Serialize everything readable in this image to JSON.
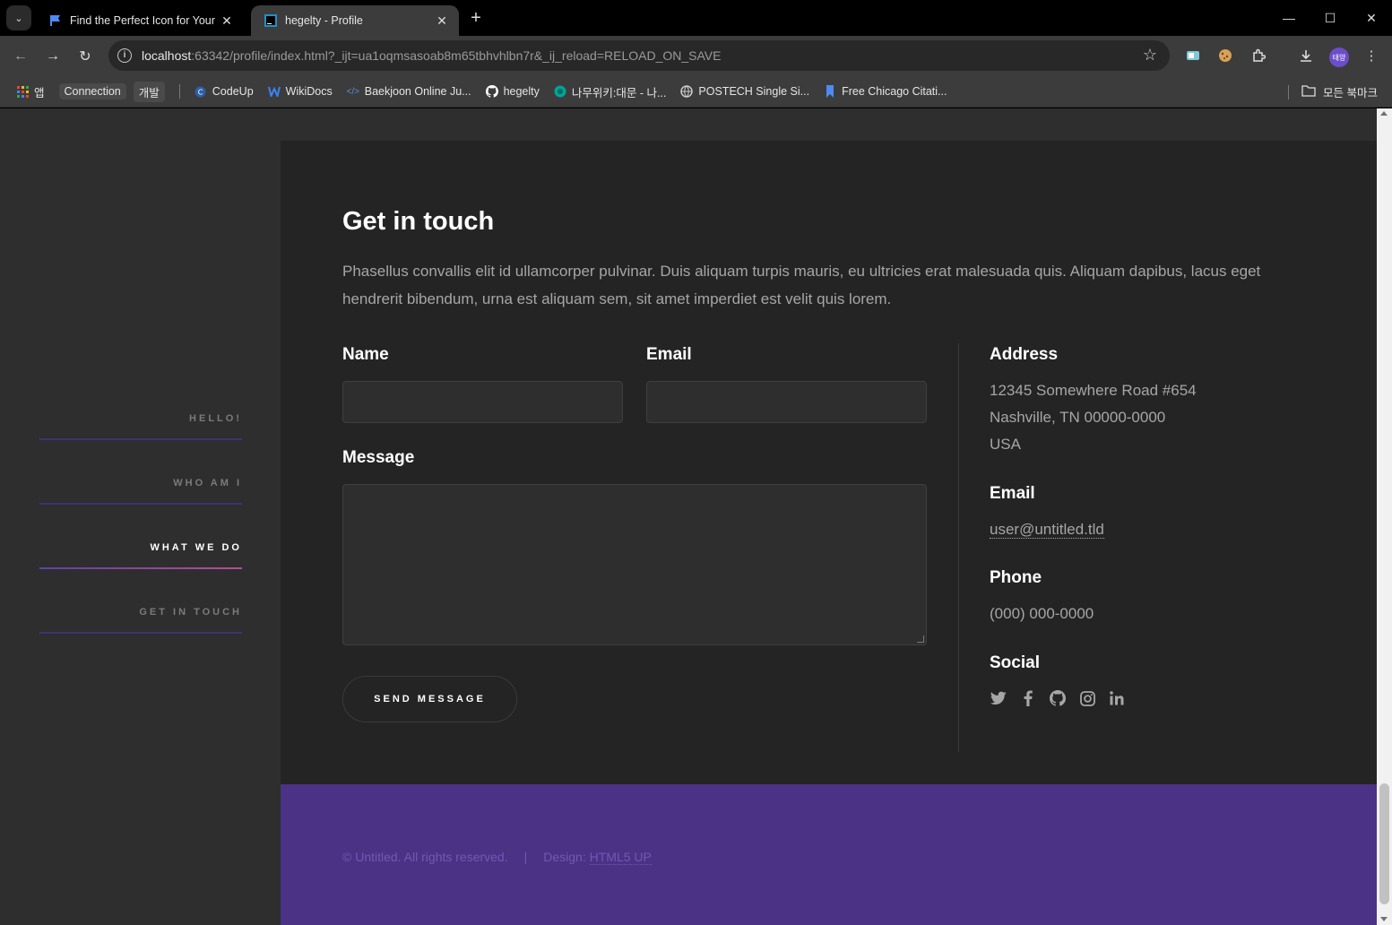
{
  "browser": {
    "tabs": [
      {
        "title": "Find the Perfect Icon for Your",
        "active": false
      },
      {
        "title": "hegelty - Profile",
        "active": true
      }
    ],
    "url_host": "localhost",
    "url_rest": ":63342/profile/index.html?_ijt=ua1oqmsasoab8m65tbhvhlbn7r&_ij_reload=RELOAD_ON_SAVE",
    "profile_initials": "태양",
    "bookmarks": {
      "apps": "앱",
      "chip1": "Connection",
      "chip2": "개발",
      "items": [
        "CodeUp",
        "WikiDocs",
        "Baekjoon Online Ju...",
        "hegelty",
        "나무위키:대문 - 나...",
        "POSTECH Single Si...",
        "Free Chicago Citati..."
      ],
      "all_bookmarks": "모든 북마크"
    }
  },
  "sidebar": {
    "items": [
      {
        "label": "HELLO!"
      },
      {
        "label": "WHO AM I"
      },
      {
        "label": "WHAT WE DO"
      },
      {
        "label": "GET IN TOUCH"
      }
    ]
  },
  "contact": {
    "title": "Get in touch",
    "intro": "Phasellus convallis elit id ullamcorper pulvinar. Duis aliquam turpis mauris, eu ultricies erat malesuada quis. Aliquam dapibus, lacus eget hendrerit bibendum, urna est aliquam sem, sit amet imperdiet est velit quis lorem.",
    "form": {
      "name_label": "Name",
      "name_value": "",
      "email_label": "Email",
      "email_value": "",
      "message_label": "Message",
      "message_value": "",
      "send_label": "SEND MESSAGE"
    },
    "info": {
      "address_heading": "Address",
      "address_line1": "12345 Somewhere Road #654",
      "address_line2": "Nashville, TN 00000-0000",
      "address_line3": "USA",
      "email_heading": "Email",
      "email_value": "user@untitled.tld",
      "phone_heading": "Phone",
      "phone_value": "(000) 000-0000",
      "social_heading": "Social",
      "social_icons": [
        "twitter-icon",
        "facebook-icon",
        "github-icon",
        "instagram-icon",
        "linkedin-icon"
      ]
    }
  },
  "footer": {
    "copyright": "© Untitled. All rights reserved.",
    "separator": "|",
    "design_prefix": "Design:",
    "design_link": "HTML5 UP"
  },
  "colors": {
    "accent": "#5e42a6",
    "footer_bg": "#4b3285",
    "wrapper_bg": "#242424",
    "page_bg": "#2e2e2e",
    "active_gradient_end": "#b74e91"
  }
}
